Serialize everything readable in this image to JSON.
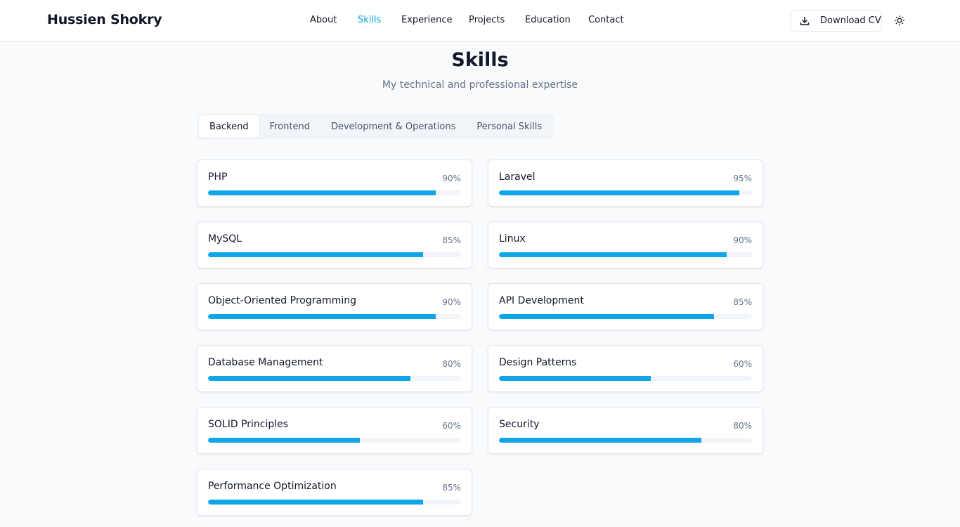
{
  "brand": "Hussien Shokry",
  "nav": [
    {
      "label": "About",
      "active": false
    },
    {
      "label": "Skills",
      "active": true
    },
    {
      "label": "Experience",
      "active": false
    },
    {
      "label": "Projects",
      "active": false
    },
    {
      "label": "Education",
      "active": false
    },
    {
      "label": "Contact",
      "active": false
    }
  ],
  "header_actions": {
    "download_label": "Download CV",
    "download_icon": "download-icon",
    "theme_icon": "sun-icon"
  },
  "section": {
    "title": "Skills",
    "subtitle": "My technical and professional expertise"
  },
  "tabs": [
    {
      "label": "Backend",
      "active": true
    },
    {
      "label": "Frontend",
      "active": false
    },
    {
      "label": "Development & Operations",
      "active": false
    },
    {
      "label": "Personal Skills",
      "active": false
    }
  ],
  "skills": [
    {
      "name": "PHP",
      "percent": "90%",
      "level": 0.9
    },
    {
      "name": "Laravel",
      "percent": "95%",
      "level": 0.95
    },
    {
      "name": "MySQL",
      "percent": "85%",
      "level": 0.85
    },
    {
      "name": "Linux",
      "percent": "90%",
      "level": 0.9
    },
    {
      "name": "Object-Oriented Programming",
      "percent": "90%",
      "level": 0.9
    },
    {
      "name": "API Development",
      "percent": "85%",
      "level": 0.85
    },
    {
      "name": "Database Management",
      "percent": "80%",
      "level": 0.8
    },
    {
      "name": "Design Patterns",
      "percent": "60%",
      "level": 0.6
    },
    {
      "name": "SOLID Principles",
      "percent": "60%",
      "level": 0.6
    },
    {
      "name": "Security",
      "percent": "80%",
      "level": 0.8
    },
    {
      "name": "Performance Optimization",
      "percent": "85%",
      "level": 0.85
    }
  ],
  "colors": {
    "accent": "#0ea5e9",
    "text": "#0f172a",
    "muted": "#64748b",
    "track": "#f1f5f9"
  }
}
